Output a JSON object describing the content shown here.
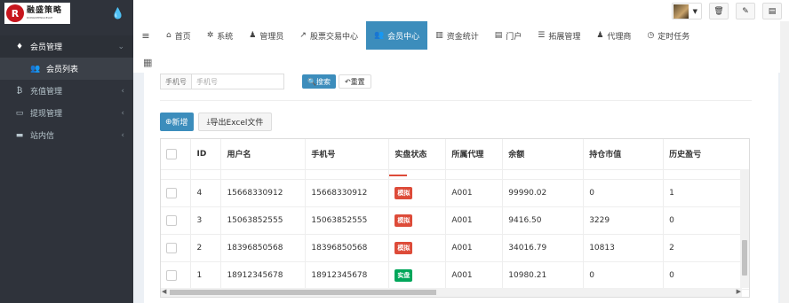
{
  "brand": {
    "logo_text": "融盛策略",
    "logo_sub": "RONGSHENGCELUE",
    "logo_mark": "R"
  },
  "sidebar": {
    "items": [
      {
        "label": "会员管理",
        "icon": "user-icon",
        "glyph": "♦",
        "expanded": true
      },
      {
        "label": "会员列表",
        "icon": "users-icon",
        "glyph": "👥",
        "sub": true
      },
      {
        "label": "充值管理",
        "icon": "bitcoin-icon",
        "glyph": "₿"
      },
      {
        "label": "提现管理",
        "icon": "card-icon",
        "glyph": "▭"
      },
      {
        "label": "站内信",
        "icon": "folder-icon",
        "glyph": "▬"
      }
    ]
  },
  "nav": {
    "tabs": [
      {
        "label": "首页",
        "icon": "home-icon",
        "glyph": "⌂"
      },
      {
        "label": "系统",
        "icon": "gear-icon",
        "glyph": "✲"
      },
      {
        "label": "管理员",
        "icon": "user-icon",
        "glyph": "♟"
      },
      {
        "label": "股票交易中心",
        "icon": "line-chart-icon",
        "glyph": "↗"
      },
      {
        "label": "会员中心",
        "icon": "users-icon",
        "glyph": "👥",
        "active": true
      },
      {
        "label": "资金统计",
        "icon": "bar-chart-icon",
        "glyph": "▥"
      },
      {
        "label": "门户",
        "icon": "card-icon",
        "glyph": "▤"
      },
      {
        "label": "拓展管理",
        "icon": "list-icon",
        "glyph": "☰"
      },
      {
        "label": "代理商",
        "icon": "person-icon",
        "glyph": "♟"
      },
      {
        "label": "定时任务",
        "icon": "clock-icon",
        "glyph": "◷"
      }
    ]
  },
  "search": {
    "label": "手机号",
    "placeholder": "手机号",
    "search_btn": "搜索",
    "reset_btn": "重置"
  },
  "actions": {
    "add": "新增",
    "export": "导出Excel文件"
  },
  "table": {
    "headers": [
      "ID",
      "用户名",
      "手机号",
      "实盘状态",
      "所属代理",
      "余额",
      "持仓市值",
      "历史盈亏"
    ],
    "rows": [
      {
        "id": "4",
        "username": "15668330912",
        "phone": "15668330912",
        "status": "模拟",
        "status_type": "sim",
        "agent": "A001",
        "balance": "99990.02",
        "holding": "0",
        "history": "1"
      },
      {
        "id": "3",
        "username": "15063852555",
        "phone": "15063852555",
        "status": "模拟",
        "status_type": "sim",
        "agent": "A001",
        "balance": "9416.50",
        "holding": "3229",
        "history": "0"
      },
      {
        "id": "2",
        "username": "18396850568",
        "phone": "18396850568",
        "status": "模拟",
        "status_type": "sim",
        "agent": "A001",
        "balance": "34016.79",
        "holding": "10813",
        "history": "2"
      },
      {
        "id": "1",
        "username": "18912345678",
        "phone": "18912345678",
        "status": "实盘",
        "status_type": "real",
        "agent": "A001",
        "balance": "10980.21",
        "holding": "0",
        "history": "0"
      }
    ]
  },
  "colors": {
    "sidebar_bg": "#2f333b",
    "accent": "#3c8dbc",
    "badge_sim": "#dd4b39",
    "badge_real": "#00a65a"
  }
}
